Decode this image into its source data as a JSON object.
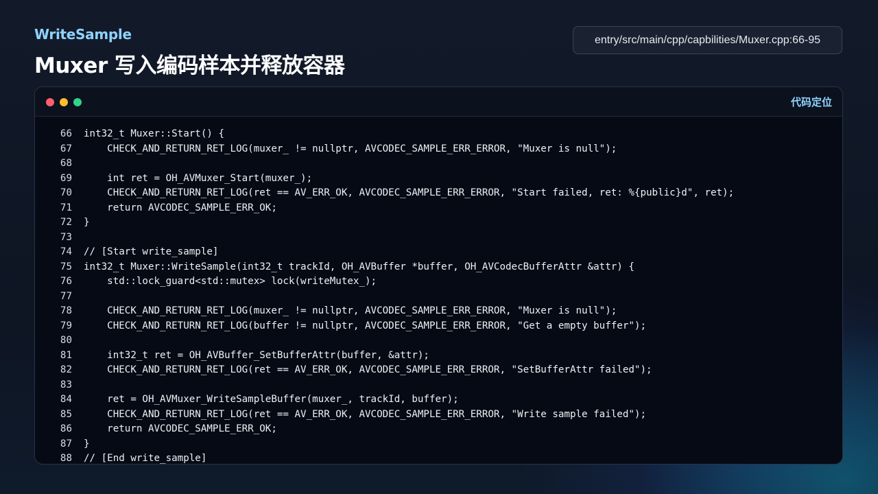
{
  "header": {
    "subtitle": "WriteSample",
    "title": "Muxer 写入编码样本并释放容器",
    "file_path": "entry/src/main/cpp/capbilities/Muxer.cpp:66-95"
  },
  "window": {
    "locate_label": "代码定位",
    "dot_colors": [
      "#ff5f6d",
      "#ffbd2e",
      "#2fd48a"
    ]
  },
  "code": {
    "lines": [
      {
        "num": "66",
        "text": "int32_t Muxer::Start() {"
      },
      {
        "num": "67",
        "text": "    CHECK_AND_RETURN_RET_LOG(muxer_ != nullptr, AVCODEC_SAMPLE_ERR_ERROR, \"Muxer is null\");"
      },
      {
        "num": "68",
        "text": ""
      },
      {
        "num": "69",
        "text": "    int ret = OH_AVMuxer_Start(muxer_);"
      },
      {
        "num": "70",
        "text": "    CHECK_AND_RETURN_RET_LOG(ret == AV_ERR_OK, AVCODEC_SAMPLE_ERR_ERROR, \"Start failed, ret: %{public}d\", ret);"
      },
      {
        "num": "71",
        "text": "    return AVCODEC_SAMPLE_ERR_OK;"
      },
      {
        "num": "72",
        "text": "}"
      },
      {
        "num": "73",
        "text": ""
      },
      {
        "num": "74",
        "text": "// [Start write_sample]"
      },
      {
        "num": "75",
        "text": "int32_t Muxer::WriteSample(int32_t trackId, OH_AVBuffer *buffer, OH_AVCodecBufferAttr &attr) {"
      },
      {
        "num": "76",
        "text": "    std::lock_guard<std::mutex> lock(writeMutex_);"
      },
      {
        "num": "77",
        "text": ""
      },
      {
        "num": "78",
        "text": "    CHECK_AND_RETURN_RET_LOG(muxer_ != nullptr, AVCODEC_SAMPLE_ERR_ERROR, \"Muxer is null\");"
      },
      {
        "num": "79",
        "text": "    CHECK_AND_RETURN_RET_LOG(buffer != nullptr, AVCODEC_SAMPLE_ERR_ERROR, \"Get a empty buffer\");"
      },
      {
        "num": "80",
        "text": ""
      },
      {
        "num": "81",
        "text": "    int32_t ret = OH_AVBuffer_SetBufferAttr(buffer, &attr);"
      },
      {
        "num": "82",
        "text": "    CHECK_AND_RETURN_RET_LOG(ret == AV_ERR_OK, AVCODEC_SAMPLE_ERR_ERROR, \"SetBufferAttr failed\");"
      },
      {
        "num": "83",
        "text": ""
      },
      {
        "num": "84",
        "text": "    ret = OH_AVMuxer_WriteSampleBuffer(muxer_, trackId, buffer);"
      },
      {
        "num": "85",
        "text": "    CHECK_AND_RETURN_RET_LOG(ret == AV_ERR_OK, AVCODEC_SAMPLE_ERR_ERROR, \"Write sample failed\");"
      },
      {
        "num": "86",
        "text": "    return AVCODEC_SAMPLE_ERR_OK;"
      },
      {
        "num": "87",
        "text": "}"
      },
      {
        "num": "88",
        "text": "// [End write_sample]"
      }
    ]
  }
}
